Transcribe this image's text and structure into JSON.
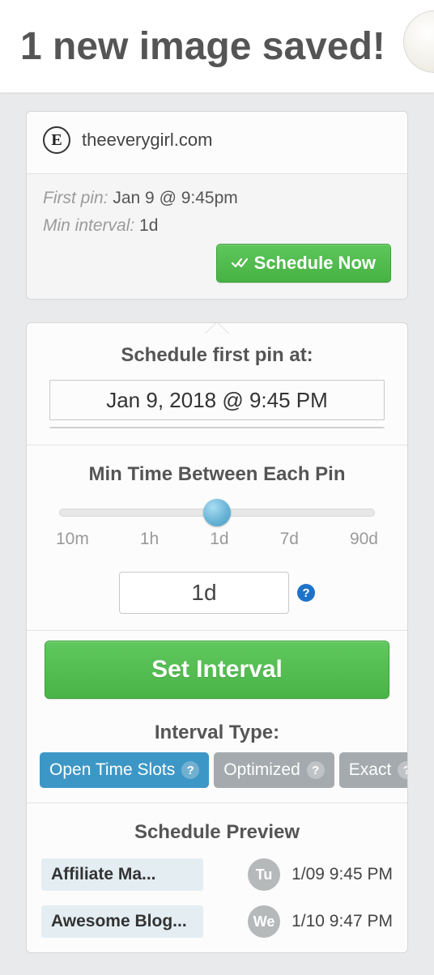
{
  "header": {
    "title": "1 new image saved!"
  },
  "source": {
    "logo_letter": "E",
    "domain": "theeverygirl.com"
  },
  "summary": {
    "first_pin_label": "First pin:",
    "first_pin_value": "Jan 9 @ 9:45pm",
    "min_interval_label": "Min interval:",
    "min_interval_value": "1d",
    "schedule_now_label": "Schedule Now"
  },
  "schedule": {
    "section_title": "Schedule first pin at:",
    "datetime_value": "Jan 9, 2018 @ 9:45 PM"
  },
  "interval": {
    "section_title": "Min Time Between Each Pin",
    "ticks": [
      "10m",
      "1h",
      "1d",
      "7d",
      "90d"
    ],
    "slider_pct": 50,
    "value": "1d",
    "set_button_label": "Set Interval"
  },
  "interval_type": {
    "section_title": "Interval Type:",
    "options": [
      {
        "label": "Open Time Slots",
        "active": true
      },
      {
        "label": "Optimized",
        "active": false
      },
      {
        "label": "Exact",
        "active": false
      }
    ]
  },
  "preview": {
    "section_title": "Schedule Preview",
    "rows": [
      {
        "board": "Affiliate Ma...",
        "day": "Tu",
        "time": "1/09 9:45 PM"
      },
      {
        "board": "Awesome Blog...",
        "day": "We",
        "time": "1/10 9:47 PM"
      }
    ]
  }
}
